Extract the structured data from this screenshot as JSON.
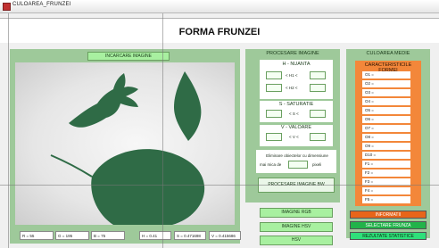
{
  "window": {
    "title": "CULOAREA_FRUNZEI"
  },
  "page_title": "FORMA FRUNZEI",
  "left": {
    "load_button": "INCARCARE IMAGINE",
    "status": [
      {
        "label": "R = ",
        "value": "55"
      },
      {
        "label": "G = ",
        "value": "195"
      },
      {
        "label": "B = ",
        "value": "75"
      },
      {
        "label": "H = ",
        "value": "0.41"
      },
      {
        "label": "S = ",
        "value": "0.471698"
      },
      {
        "label": "V = ",
        "value": "0.415686"
      }
    ]
  },
  "processing": {
    "title": "PROCESARE IMAGINE",
    "hue_title": "H - NUANTA",
    "h1_label": "< H1 <",
    "h2_label": "< H2 <",
    "sat_title": "S - SATURATIE",
    "s_label": "< S <",
    "val_title": "V - VALOARE",
    "v_label": "< V <",
    "remove_text_1": "Eliminare obiectelor cu dimensiune",
    "remove_text_2_a": "mai mica de",
    "remove_text_2_b": "pixeli",
    "process_bw_button": "PROCESARE IMAGINE BW"
  },
  "views": {
    "rgb": "IMAGINE RGB",
    "hsv": "IMAGINE HSV",
    "hsv_short": "HSV"
  },
  "color_panel": {
    "title": "CULOAREA MEDIE",
    "subtitle": "CARACTERISTICILE FORMEI",
    "fields": [
      "O1 =",
      "O2 =",
      "O3 =",
      "O4 =",
      "O5 =",
      "O6 =",
      "O7 =",
      "O8 =",
      "O9 =",
      "D10 =",
      "F1 =",
      "F2 =",
      "F3 =",
      "F4 =",
      "F5 ="
    ],
    "buttons": [
      {
        "label": "INFORMATII",
        "color": "#e8651a"
      },
      {
        "label": "SELECTARE FRUNZA",
        "color": "#22b34a"
      },
      {
        "label": "REZULTATE STATISTICE",
        "color": "#2ee07a"
      }
    ]
  },
  "colors": {
    "panel_green": "#9ec99a",
    "button_green": "#a8f0a0",
    "orange": "#f3873a",
    "leaf": "#2f6b46"
  }
}
